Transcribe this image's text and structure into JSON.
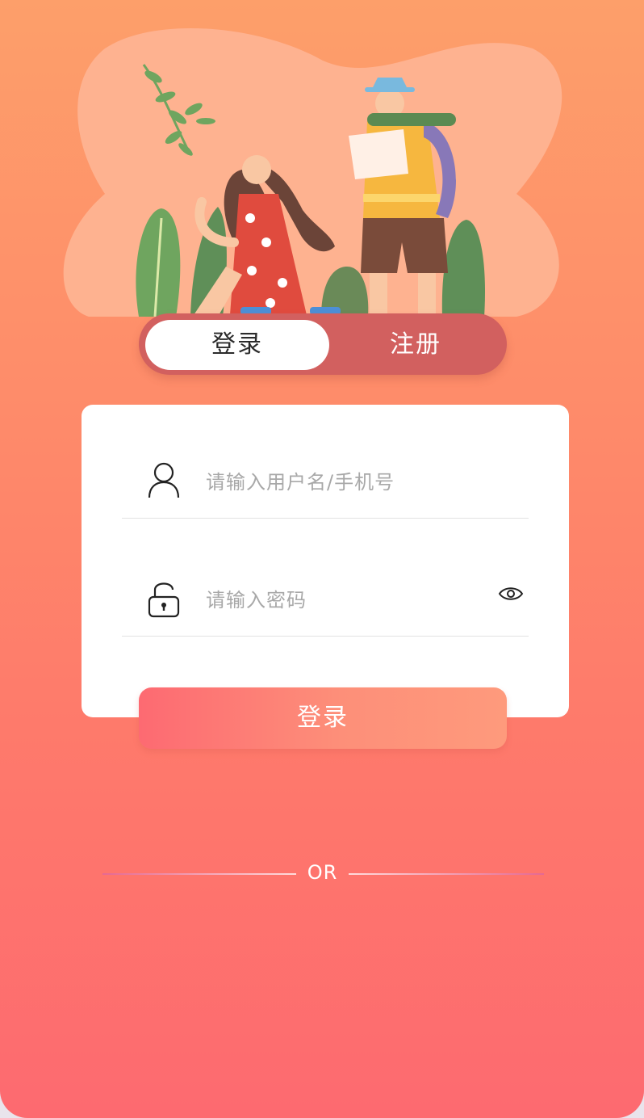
{
  "tabs": {
    "login": "登录",
    "register": "注册",
    "active": "login"
  },
  "form": {
    "username": {
      "placeholder": "请输入用户名/手机号",
      "icon": "user-icon"
    },
    "password": {
      "placeholder": "请输入密码",
      "icon": "lock-icon",
      "toggle_icon": "eye-icon"
    }
  },
  "login_button": "登录",
  "divider": {
    "text": "OR"
  },
  "colors": {
    "gradient_top": "#fd9f6a",
    "gradient_bottom": "#fd6a70",
    "tab_bar": "#d2605f",
    "card": "#ffffff",
    "placeholder": "#a8a8a8"
  }
}
